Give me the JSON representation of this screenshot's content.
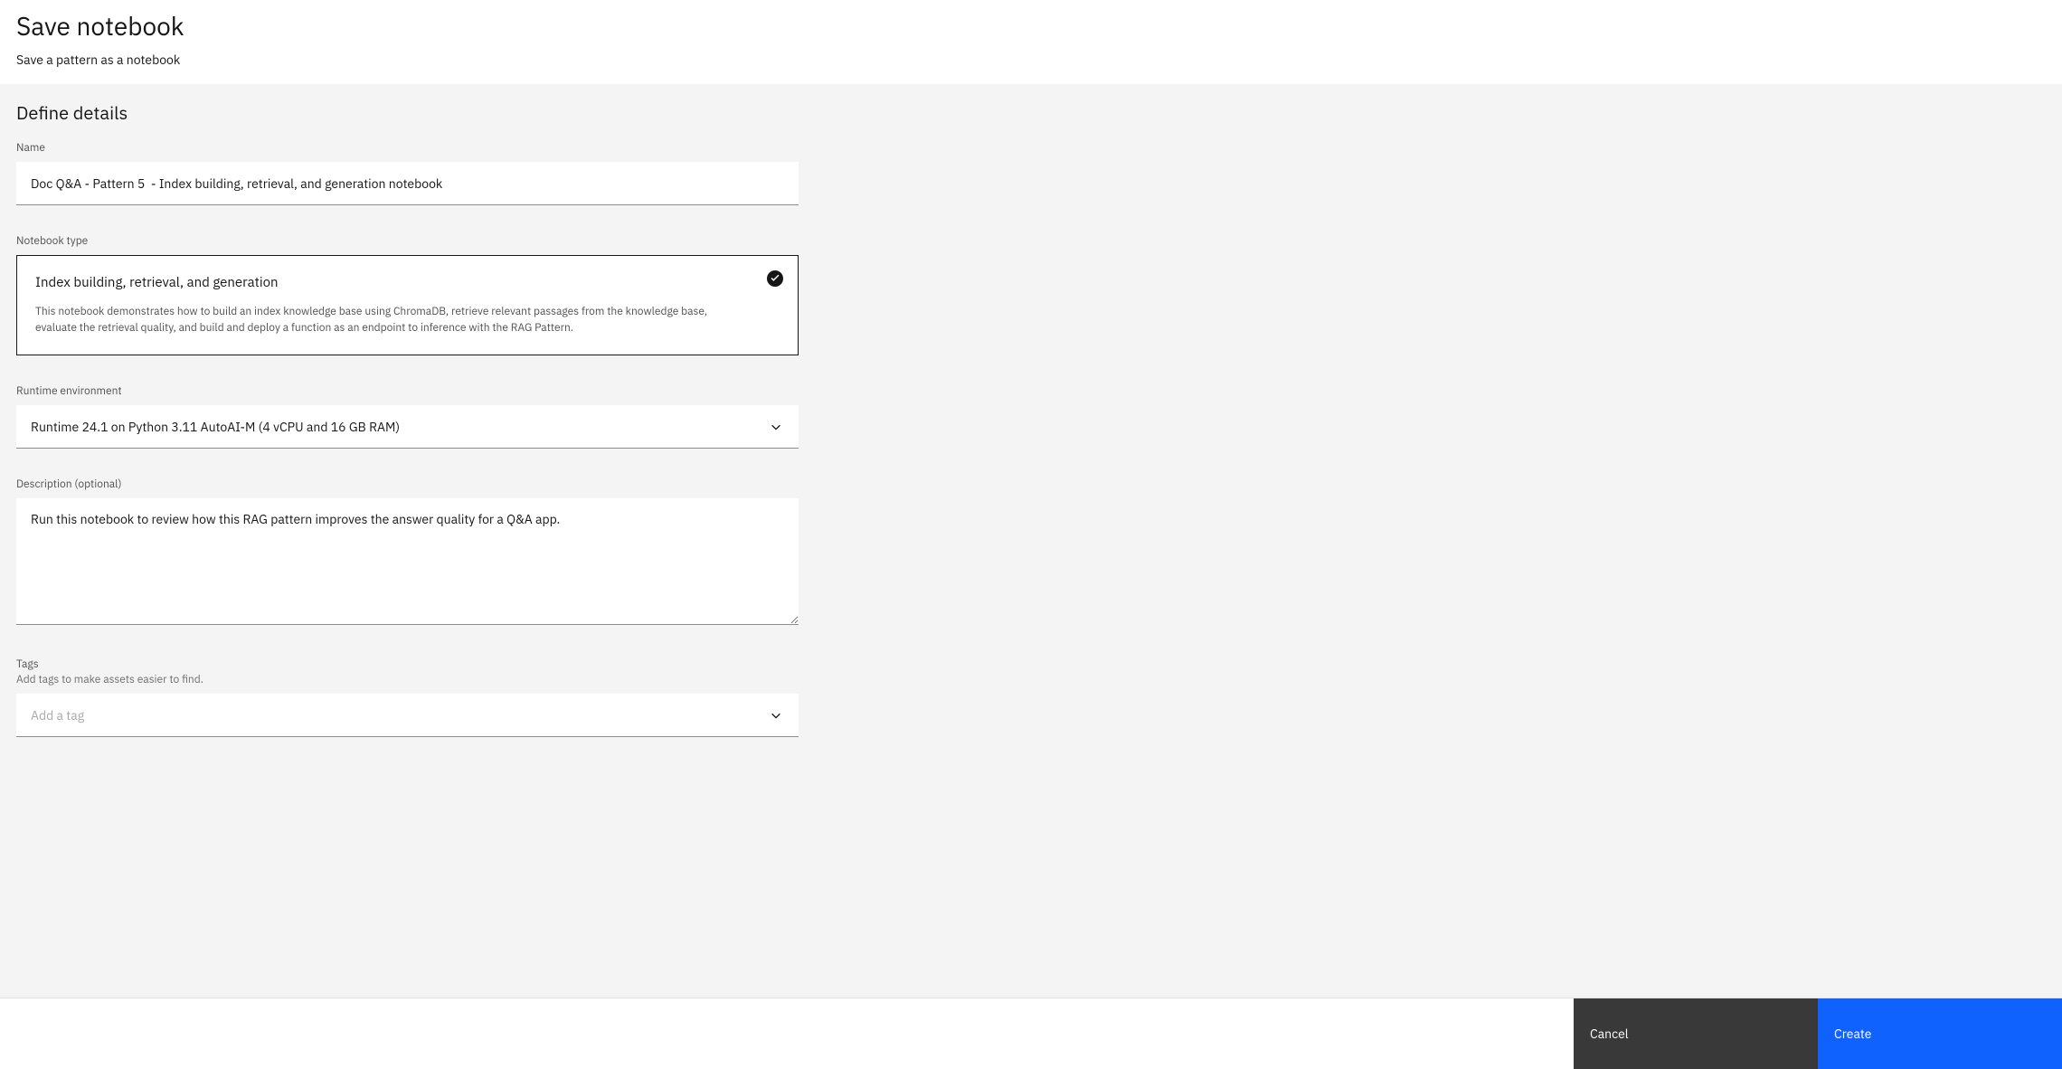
{
  "header": {
    "title": "Save notebook",
    "subtitle": "Save a pattern as a notebook"
  },
  "section": {
    "title": "Define details"
  },
  "fields": {
    "name": {
      "label": "Name",
      "value": "Doc Q&A - Pattern 5  - Index building, retrieval, and generation notebook"
    },
    "notebookType": {
      "label": "Notebook type",
      "selected": {
        "title": "Index building, retrieval, and generation",
        "description": "This notebook demonstrates how to build an index knowledge base using ChromaDB, retrieve relevant passages from the knowledge base, evaluate the retrieval quality, and build and deploy a function as an endpoint to inference with the RAG Pattern."
      }
    },
    "runtime": {
      "label": "Runtime environment",
      "value": "Runtime 24.1 on Python 3.11 AutoAI-M (4 vCPU and 16 GB RAM)"
    },
    "description": {
      "label": "Description (optional)",
      "value": "Run this notebook to review how this RAG pattern improves the answer quality for a Q&A app."
    },
    "tags": {
      "label": "Tags",
      "sublabel": "Add tags to make assets easier to find.",
      "placeholder": "Add a tag"
    }
  },
  "footer": {
    "cancel": "Cancel",
    "create": "Create"
  }
}
